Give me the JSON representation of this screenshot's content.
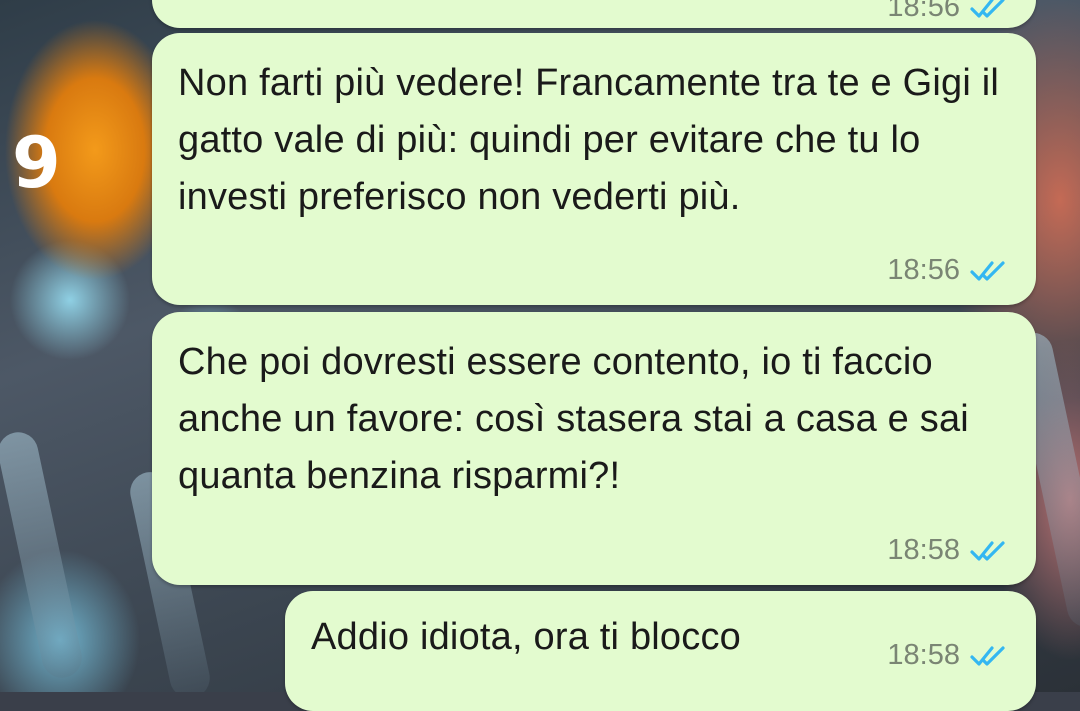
{
  "chat": {
    "side_label": "9",
    "messages": [
      {
        "text": "",
        "time": "18:56",
        "status": "read"
      },
      {
        "text": "Non farti più vedere! Francamente tra te e Gigi il gatto vale di più: quindi per evitare che tu lo investi preferisco non vederti più.",
        "time": "18:56",
        "status": "read"
      },
      {
        "text": "Che poi dovresti essere contento, io ti faccio anche un favore: così stasera stai a casa e sai quanta benzina risparmi?!",
        "time": "18:58",
        "status": "read"
      },
      {
        "text": "Addio idiota, ora ti blocco",
        "time": "18:58",
        "status": "read"
      }
    ]
  },
  "colors": {
    "bubble": "#e3fbcf",
    "tick_read": "#34b7f1",
    "time_text": "#7a8574"
  },
  "icons": {
    "tick": "double-check-icon"
  }
}
